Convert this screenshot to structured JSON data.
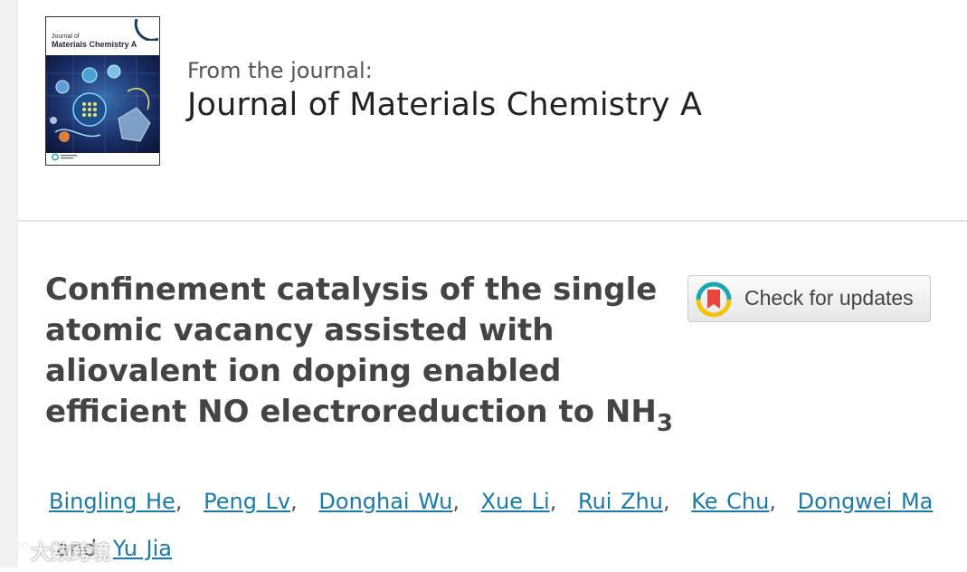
{
  "journal": {
    "cover_title_small": "Journal of",
    "cover_title_main": "Materials Chemistry A",
    "from_label": "From the journal:",
    "name": "Journal of Materials Chemistry A"
  },
  "article": {
    "title_main": "Confinement catalysis of the single atomic vacancy assisted with aliovalent ion doping enabled efficient NO electroreduction to NH",
    "title_subscript": "3"
  },
  "updates_button": {
    "label": "Check for updates"
  },
  "authors": [
    {
      "name": "Bingling He"
    },
    {
      "name": "Peng Lv"
    },
    {
      "name": "Donghai Wu"
    },
    {
      "name": "Xue Li"
    },
    {
      "name": "Rui Zhu"
    },
    {
      "name": "Ke Chu"
    },
    {
      "name": "Dongwei Ma"
    },
    {
      "name": "Yu Jia"
    }
  ],
  "author_separator": ",",
  "author_conjunction": "and",
  "watermark": {
    "text": "大数跨境"
  },
  "colors": {
    "link": "#1a7aa8",
    "title": "#444444",
    "updates_red": "#e8473f",
    "updates_yellow": "#f4c20d",
    "updates_teal": "#1aa7b5"
  }
}
